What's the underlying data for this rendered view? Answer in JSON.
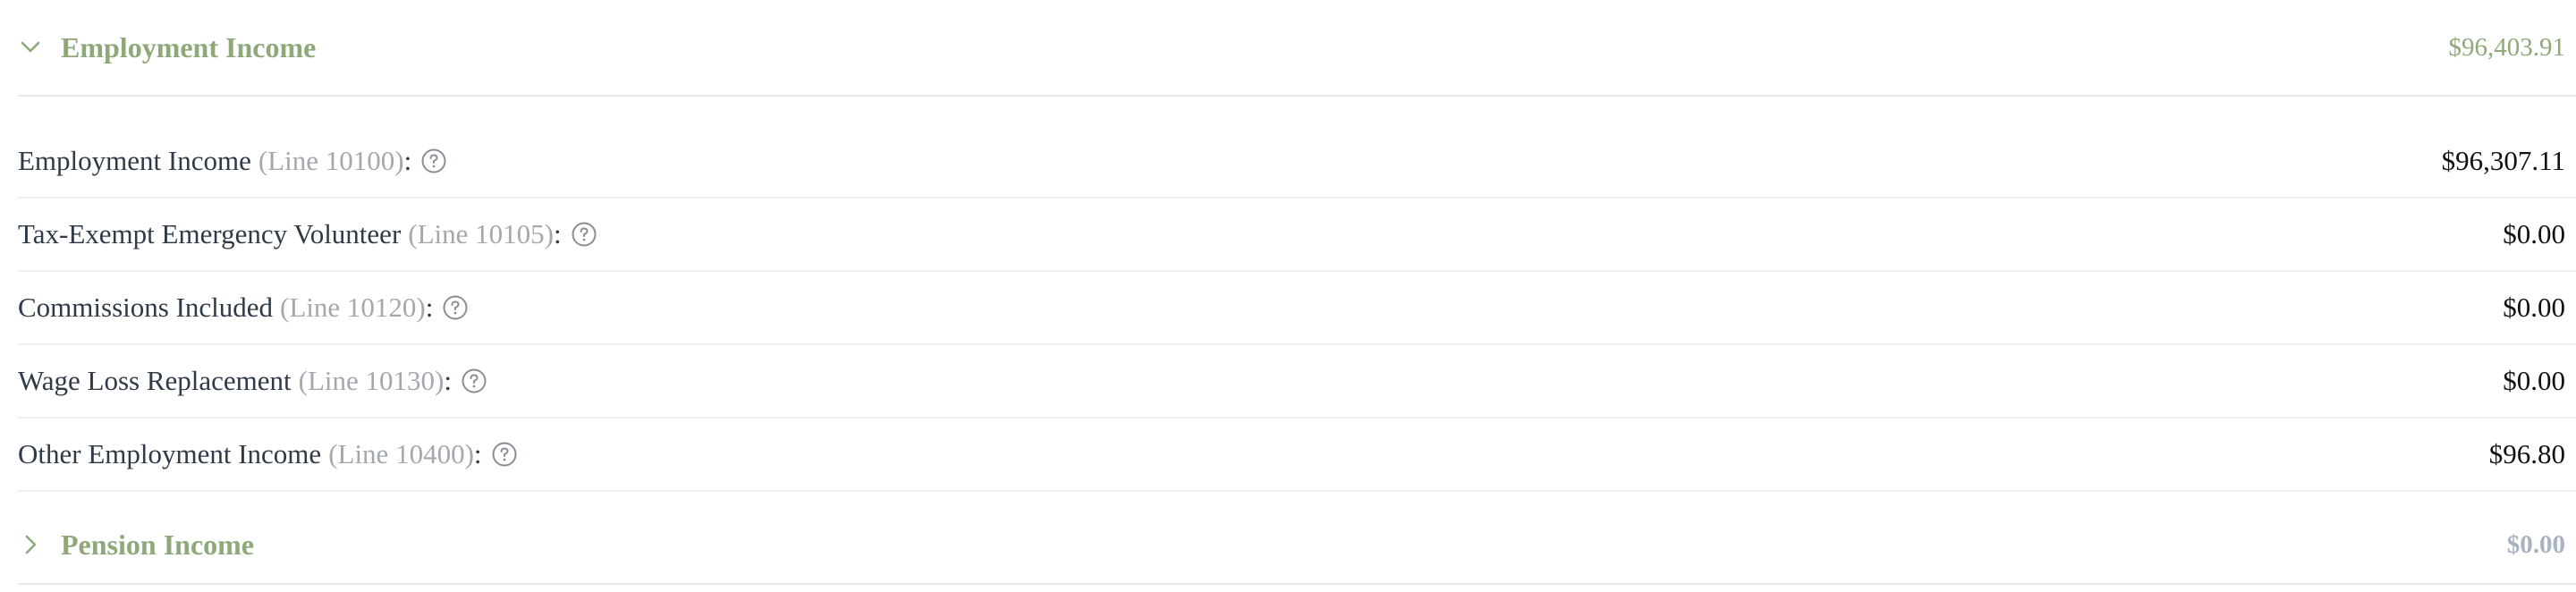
{
  "sections": [
    {
      "title": "Employment Income",
      "total": "$96,403.91",
      "expanded": true,
      "rows": [
        {
          "label": "Employment Income",
          "line": "(Line 10100)",
          "value": "$96,307.11"
        },
        {
          "label": "Tax-Exempt Emergency Volunteer",
          "line": "(Line 10105)",
          "value": "$0.00"
        },
        {
          "label": "Commissions Included",
          "line": "(Line 10120)",
          "value": "$0.00"
        },
        {
          "label": "Wage Loss Replacement",
          "line": "(Line 10130)",
          "value": "$0.00"
        },
        {
          "label": "Other Employment Income",
          "line": "(Line 10400)",
          "value": "$96.80"
        }
      ]
    },
    {
      "title": "Pension Income",
      "total": "$0.00",
      "expanded": false
    }
  ],
  "icons": {
    "expanded": "chevron-down-icon",
    "collapsed": "chevron-right-icon",
    "help": "question-circle-icon"
  },
  "colors": {
    "section_accent": "#8fa87a",
    "muted_total": "#a9b2bf",
    "line_ref": "#a3a8ae"
  },
  "colon": ":"
}
